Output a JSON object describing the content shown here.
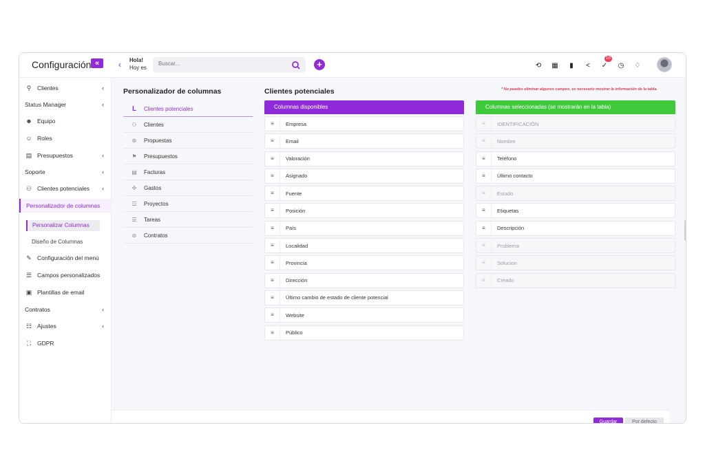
{
  "app": {
    "title": "Configuración",
    "collapse_icon": "double-chevron-left-icon"
  },
  "header": {
    "greeting": "Hola!",
    "subgreeting": "Hoy es",
    "search_placeholder": "Buscar...",
    "notification_count": "10"
  },
  "sidebar": {
    "items": [
      {
        "label": "Clientes",
        "icon": "clients-icon"
      },
      {
        "label": "Status Manager"
      },
      {
        "label": "Equipo",
        "icon": "add-user-icon"
      },
      {
        "label": "Roles",
        "icon": "roles-icon"
      },
      {
        "label": "Presupuestos",
        "icon": "document-icon"
      },
      {
        "label": "Soporte"
      },
      {
        "label": "Clientes potenciales",
        "icon": "users-icon"
      },
      {
        "label": "Personalizador de columnas"
      },
      {
        "label": "Configuración del menú",
        "icon": "edit-icon"
      },
      {
        "label": "Campos personalizados",
        "icon": "list-icon"
      },
      {
        "label": "Plantillas de email",
        "icon": "email-template-icon"
      },
      {
        "label": "Contratos"
      },
      {
        "label": "Ajustes",
        "icon": "sliders-icon"
      },
      {
        "label": "GDPR",
        "icon": "gdpr-icon"
      }
    ],
    "sub_items": [
      "Personalizar Columnas",
      "Diseño de Columnas"
    ]
  },
  "customizer": {
    "title": "Personalizador de columnas",
    "categories": [
      "Clientes potenciales",
      "Clientes",
      "Propuestas",
      "Presupuestos",
      "Facturas",
      "Gastos",
      "Proyectos",
      "Tareas",
      "Contratos"
    ]
  },
  "main": {
    "title": "Clientes potenciales",
    "note": "* No puedes eliminar algunos campos, es necesario mostrar la información de la tabla.",
    "available_header": "Columnas disponibles",
    "selected_header": "Columnas seleccionadas (se mostrarán en la tabla)",
    "available": [
      "Empresa",
      "Email",
      "Valoración",
      "Asignado",
      "Fuente",
      "Posición",
      "País",
      "Localidad",
      "Provincia",
      "Dirección",
      "Último cambio de estado de cliente potencial",
      "Website",
      "Público"
    ],
    "selected": [
      "IDENTIFICACIÓN",
      "Nombre",
      "Teléfono",
      "Último contacto",
      "Estado",
      "Etiquetas",
      "Descripción",
      "Problema",
      "Solucion",
      "Creado"
    ],
    "save_label": "Guardar",
    "default_label": "Por defecto"
  },
  "colors": {
    "accent": "#8f2bd8",
    "selected_header": "#3ec93a",
    "note": "#e5394b"
  }
}
